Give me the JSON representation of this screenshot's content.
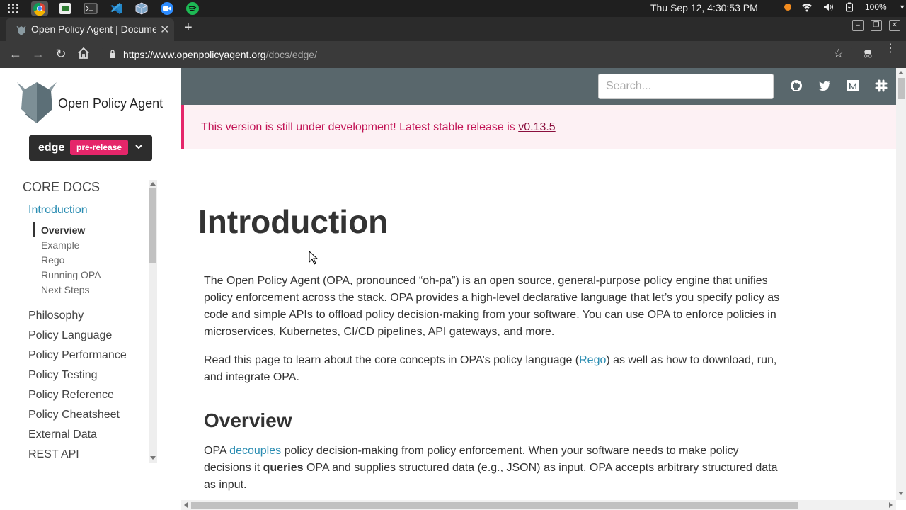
{
  "os": {
    "clock": "Thu Sep 12,  4:30:53 PM",
    "battery": "100%",
    "apps": [
      "chrome-icon",
      "slides-icon",
      "terminal-icon",
      "vscode-icon",
      "virtualbox-icon",
      "zoom-icon",
      "spotify-icon"
    ]
  },
  "browser": {
    "tab_title": "Open Policy Agent | Documentation",
    "url_host": "https://www.openpolicyagent.org",
    "url_path": "/docs/edge/"
  },
  "sidebar": {
    "logo_text": "Open Policy Agent",
    "version": "edge",
    "badge": "pre-release",
    "section": "CORE DOCS",
    "active_item": "Introduction",
    "sub_items": [
      "Overview",
      "Example",
      "Rego",
      "Running OPA",
      "Next Steps"
    ],
    "items": [
      "Philosophy",
      "Policy Language",
      "Policy Performance",
      "Policy Testing",
      "Policy Reference",
      "Policy Cheatsheet",
      "External Data",
      "REST API"
    ]
  },
  "header": {
    "search_placeholder": "Search..."
  },
  "banner": {
    "text": "This version is still under development! Latest stable release is ",
    "link": "v0.13.5"
  },
  "content": {
    "title": "Introduction",
    "p1": "The Open Policy Agent (OPA, pronounced “oh-pa”) is an open source, general-purpose policy engine that unifies policy enforcement across the stack. OPA provides a high-level declarative language that let’s you specify policy as code and simple APIs to offload policy decision-making from your software. You can use OPA to enforce policies in microservices, Kubernetes, CI/CD pipelines, API gateways, and more.",
    "p2_pre": "Read this page to learn about the core concepts in OPA’s policy language (",
    "p2_link": "Rego",
    "p2_post": ") as well as how to download, run, and integrate OPA.",
    "h2": "Overview",
    "p3_pre": "OPA ",
    "p3_link": "decouples",
    "p3_mid": " policy decision-making from policy enforcement. When your software needs to make policy decisions it ",
    "p3_bold": "queries",
    "p3_post": " OPA and supplies structured data (e.g., JSON) as input. OPA accepts arbitrary structured data as input."
  },
  "colors": {
    "header_bg": "#59676c",
    "accent": "#e5266a",
    "link": "#2b8db2"
  }
}
